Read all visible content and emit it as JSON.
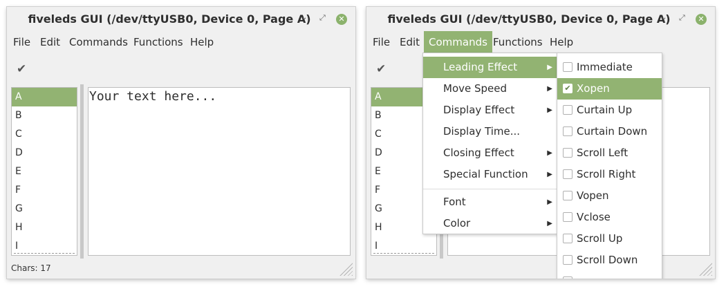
{
  "windows": [
    {
      "title": "fiveleds GUI (/dev/ttyUSB0, Device 0, Page A)",
      "menubar": [
        "File",
        "Edit",
        "Commands",
        "Functions",
        "Help"
      ],
      "toolbar_icon": "check-icon",
      "pages": [
        "A",
        "B",
        "C",
        "D",
        "E",
        "F",
        "G",
        "H",
        "I"
      ],
      "selected_page": "A",
      "editor_text": "Your text here...",
      "status": "Chars: 17"
    },
    {
      "title": "fiveleds GUI (/dev/ttyUSB0, Device 0, Page A)",
      "menubar": [
        "File",
        "Edit",
        "Commands",
        "Functions",
        "Help"
      ],
      "active_menu": "Commands",
      "pages": [
        "A",
        "B",
        "C",
        "D",
        "E",
        "F",
        "G",
        "H",
        "I"
      ],
      "selected_page": "A",
      "commands_menu": {
        "items": [
          "Leading Effect",
          "Move Speed",
          "Display Effect",
          "Display Time...",
          "Closing Effect",
          "Special Function"
        ],
        "items2": [
          "Font",
          "Color"
        ],
        "highlighted": "Leading Effect"
      },
      "leading_effect_menu": {
        "items": [
          "Immediate",
          "Xopen",
          "Curtain Up",
          "Curtain Down",
          "Scroll Left",
          "Scroll Right",
          "Vopen",
          "Vclose",
          "Scroll Up",
          "Scroll Down"
        ],
        "checked": "Xopen"
      }
    }
  ],
  "colors": {
    "accent": "#92b372",
    "close_button": "#8bb26c"
  }
}
